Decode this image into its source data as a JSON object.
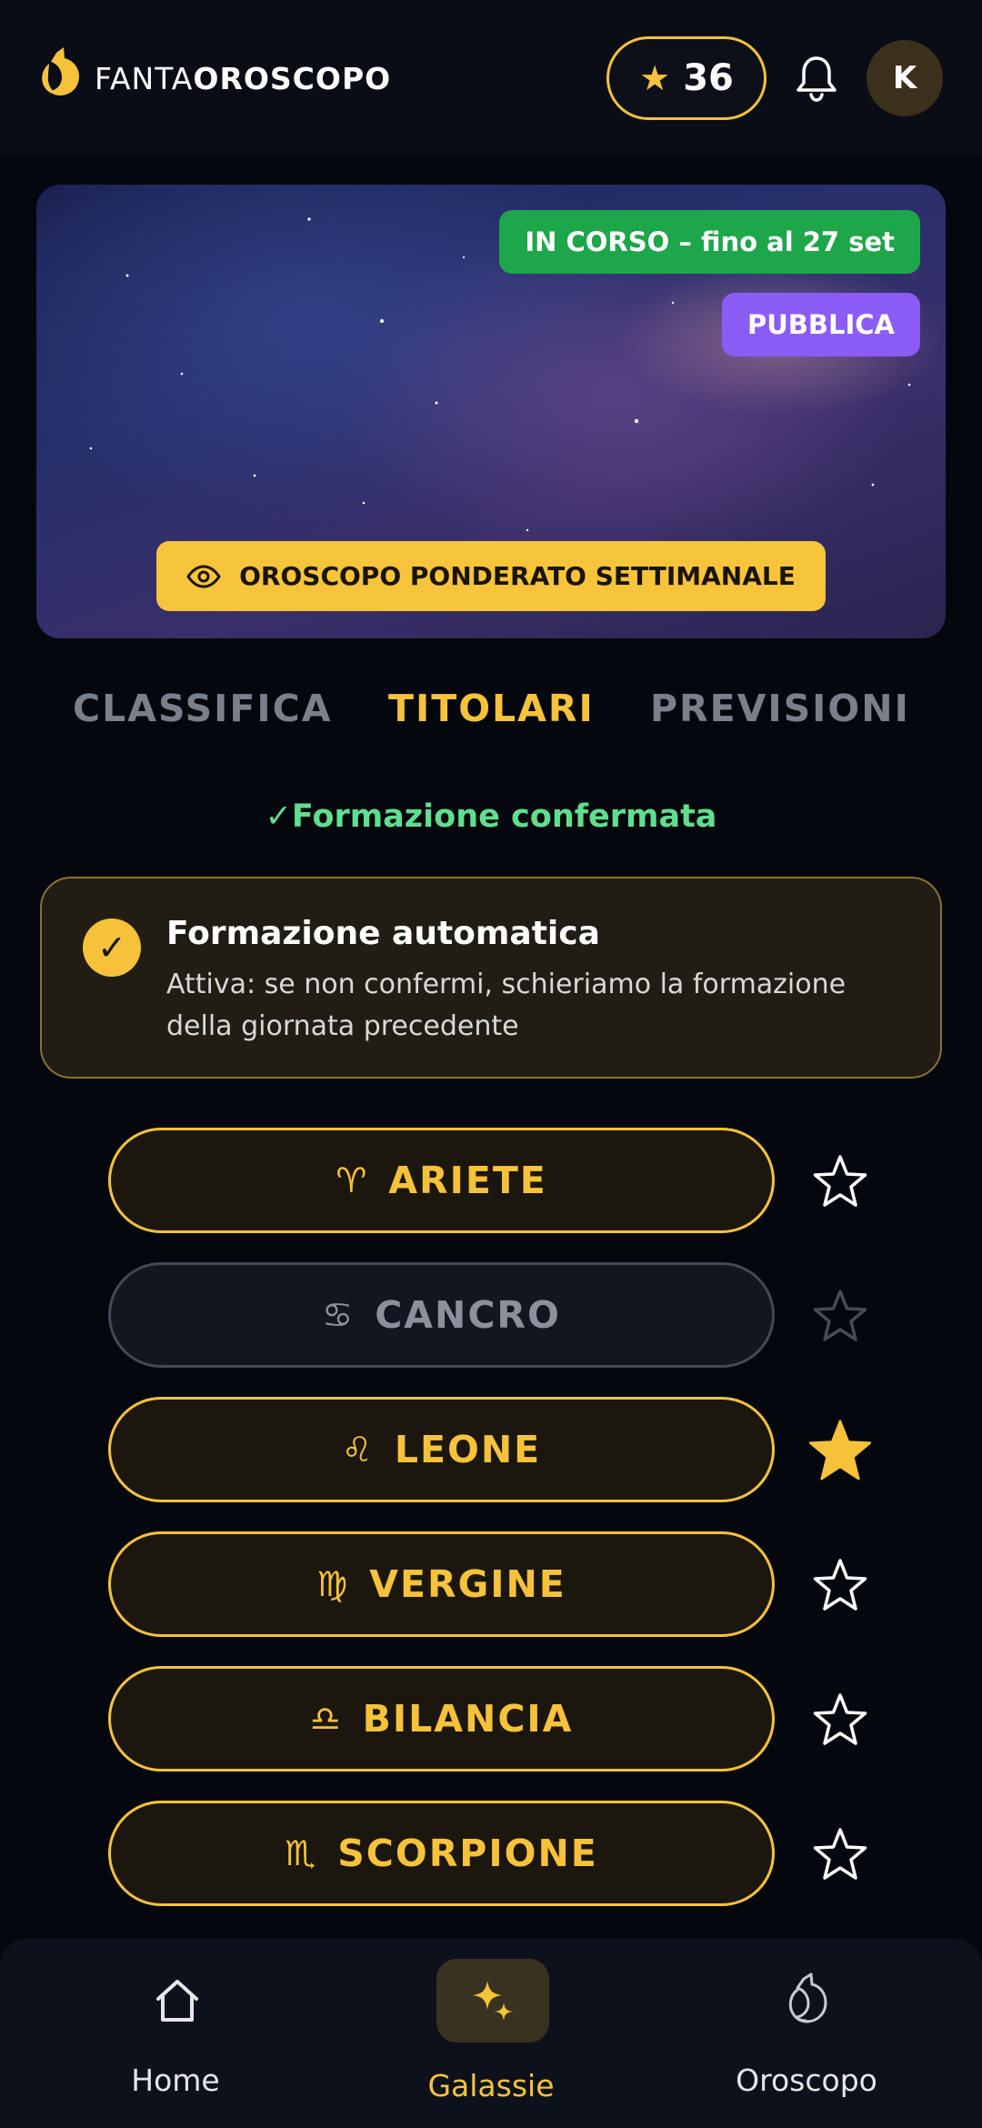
{
  "header": {
    "logo_text_light": "FANTA",
    "logo_text_bold": "OROSCOPO",
    "points": "36",
    "avatar_initial": "K",
    "icons": [
      "star-icon",
      "bell-icon"
    ]
  },
  "banner": {
    "status": "IN CORSO – fino al 27 set",
    "visibility": "PUBBLICA",
    "cta": "OROSCOPO PONDERATO SETTIMANALE"
  },
  "tabs": [
    {
      "label": "CLASSIFICA",
      "active": false
    },
    {
      "label": "TITOLARI",
      "active": true
    },
    {
      "label": "PREVISIONI",
      "active": false
    }
  ],
  "confirmed_text": "✓Formazione confermata",
  "auto_card": {
    "title": "Formazione automatica",
    "description": "Attiva: se non confermi, schieriamo la formazione della giornata precedente"
  },
  "signs": [
    {
      "glyph": "♈",
      "label": "ARIETE",
      "enabled": true,
      "starred": false
    },
    {
      "glyph": "♋",
      "label": "CANCRO",
      "enabled": false,
      "starred": false
    },
    {
      "glyph": "♌",
      "label": "LEONE",
      "enabled": true,
      "starred": true
    },
    {
      "glyph": "♍",
      "label": "VERGINE",
      "enabled": true,
      "starred": false
    },
    {
      "glyph": "♎",
      "label": "BILANCIA",
      "enabled": true,
      "starred": false
    },
    {
      "glyph": "♏",
      "label": "SCORPIONE",
      "enabled": true,
      "starred": false
    }
  ],
  "bottom_nav": [
    {
      "label": "Home",
      "icon": "home-icon",
      "active": false
    },
    {
      "label": "Galassie",
      "icon": "sparkles-icon",
      "active": true
    },
    {
      "label": "Oroscopo",
      "icon": "moon-cat-icon",
      "active": false
    }
  ],
  "colors": {
    "accent": "#f5c23a",
    "success": "#1ea64a",
    "purple": "#8b5cf6",
    "confirm_text": "#5fdf8e",
    "background": "#05070e"
  }
}
